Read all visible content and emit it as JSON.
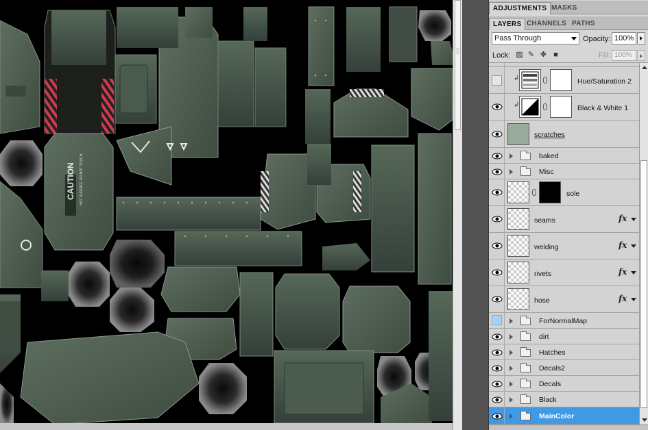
{
  "panel_tabs_top": [
    {
      "label": "ADJUSTMENTS",
      "active": true
    },
    {
      "label": "MASKS",
      "active": false
    }
  ],
  "panel_tabs_layers": [
    {
      "label": "LAYERS",
      "active": true
    },
    {
      "label": "CHANNELS",
      "active": false
    },
    {
      "label": "PATHS",
      "active": false
    }
  ],
  "blend_mode": "Pass Through",
  "opacity_label": "Opacity:",
  "opacity_value": "100%",
  "lock_label": "Lock:",
  "fill_label": "Fill:",
  "fill_value": "100%",
  "canvas_texts": {
    "caution": "CAUTION",
    "hot_surface": "HOT SURFACE DO NOT TOUCH"
  },
  "layers": [
    {
      "name": "Hue/Saturation 2",
      "kind": "adjustment",
      "visible": false,
      "selected": false
    },
    {
      "name": "Black & White 1",
      "kind": "adjustment",
      "visible": true,
      "selected": false
    },
    {
      "name": "scratches",
      "kind": "pixel",
      "visible": true,
      "selected": false,
      "fx": false
    },
    {
      "name": "baked",
      "kind": "group",
      "visible": true,
      "selected": false
    },
    {
      "name": "Misc",
      "kind": "group",
      "visible": true,
      "selected": false
    },
    {
      "name": "sole",
      "kind": "masked",
      "visible": true,
      "selected": false
    },
    {
      "name": "seams",
      "kind": "pixel",
      "visible": true,
      "selected": false,
      "fx": true
    },
    {
      "name": "welding",
      "kind": "pixel",
      "visible": true,
      "selected": false,
      "fx": true
    },
    {
      "name": "rivets",
      "kind": "pixel",
      "visible": true,
      "selected": false,
      "fx": true
    },
    {
      "name": "hose",
      "kind": "pixel",
      "visible": true,
      "selected": false,
      "fx": true
    },
    {
      "name": "ForNormalMap",
      "kind": "group",
      "visible": false,
      "selected": false
    },
    {
      "name": "dirt",
      "kind": "group",
      "visible": true,
      "selected": false
    },
    {
      "name": "Hatches",
      "kind": "group",
      "visible": true,
      "selected": false
    },
    {
      "name": "Decals2",
      "kind": "group",
      "visible": true,
      "selected": false
    },
    {
      "name": "Decals",
      "kind": "group",
      "visible": true,
      "selected": false
    },
    {
      "name": "Black",
      "kind": "group",
      "visible": true,
      "selected": false
    },
    {
      "name": "MainColor",
      "kind": "group",
      "visible": true,
      "selected": true
    }
  ],
  "fx_symbol": "fx",
  "colors": {
    "selection": "#3f9ae6",
    "panel_bg": "#d6d6d6",
    "texture_green": "#4a5a4c",
    "caution_stripe": "#d23a4e"
  }
}
